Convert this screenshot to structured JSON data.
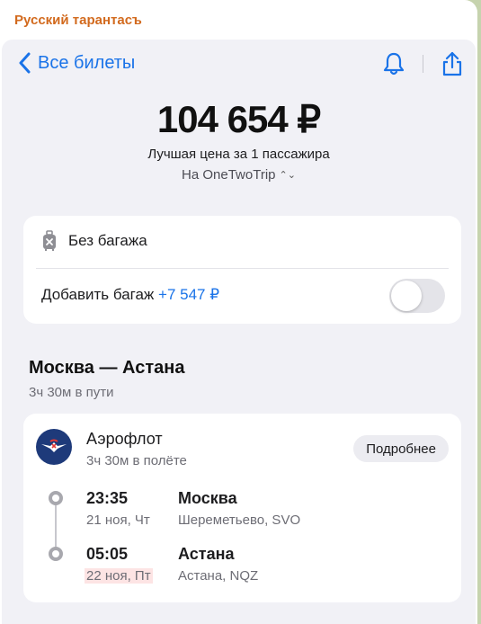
{
  "chat": {
    "sender": "Русский тарантасъ",
    "sender_color": "#d26a1e"
  },
  "nav": {
    "back_label": "Все билеты",
    "icons": [
      "chevron-left-icon",
      "bell-icon",
      "share-icon"
    ],
    "accent_color": "#1a73e8"
  },
  "price": {
    "amount": "104 654 ₽",
    "subtitle": "Лучшая цена за 1 пассажира",
    "provider": "На OneTwoTrip"
  },
  "baggage": {
    "no_baggage_label": "Без багажа",
    "add_label": "Добавить багаж",
    "add_price": "+7 547 ₽",
    "toggle_on": false
  },
  "route": {
    "title": "Москва — Астана",
    "duration": "3ч 30м в пути"
  },
  "flight": {
    "airline": "Аэрофлот",
    "flight_duration": "3ч 30м в полёте",
    "details_button": "Подробнее",
    "departure": {
      "time": "23:35",
      "date": "21 ноя, Чт",
      "city": "Москва",
      "airport": "Шереметьево, SVO"
    },
    "arrival": {
      "time": "05:05",
      "date": "22 ноя, Пт",
      "city": "Астана",
      "airport": "Астана, NQZ"
    }
  }
}
